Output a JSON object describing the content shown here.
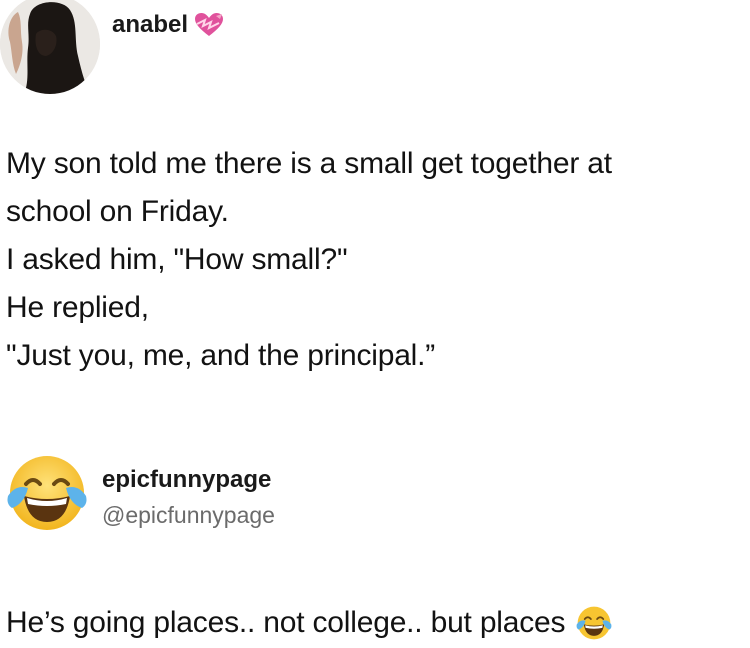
{
  "post": {
    "author": "anabel",
    "author_emoji_icon": "heart-with-ribbon-icon",
    "lines": [
      "My son told me there is a small get together at",
      "school on Friday.",
      "I asked him, \"How small?\"",
      "He replied,",
      "\"Just you, me, and the principal.”"
    ]
  },
  "source": {
    "name": "epicfunnypage",
    "handle": "@epicfunnypage",
    "avatar_icon": "tears-of-joy-emoji-icon"
  },
  "comment": {
    "text": "He’s going places.. not college.. but places",
    "trailing_icon": "tears-of-joy-emoji-icon"
  },
  "colors": {
    "text": "#121212",
    "handle": "#6b6b6b",
    "heart": "#e0529c",
    "emoji_face": "#f7c531"
  }
}
